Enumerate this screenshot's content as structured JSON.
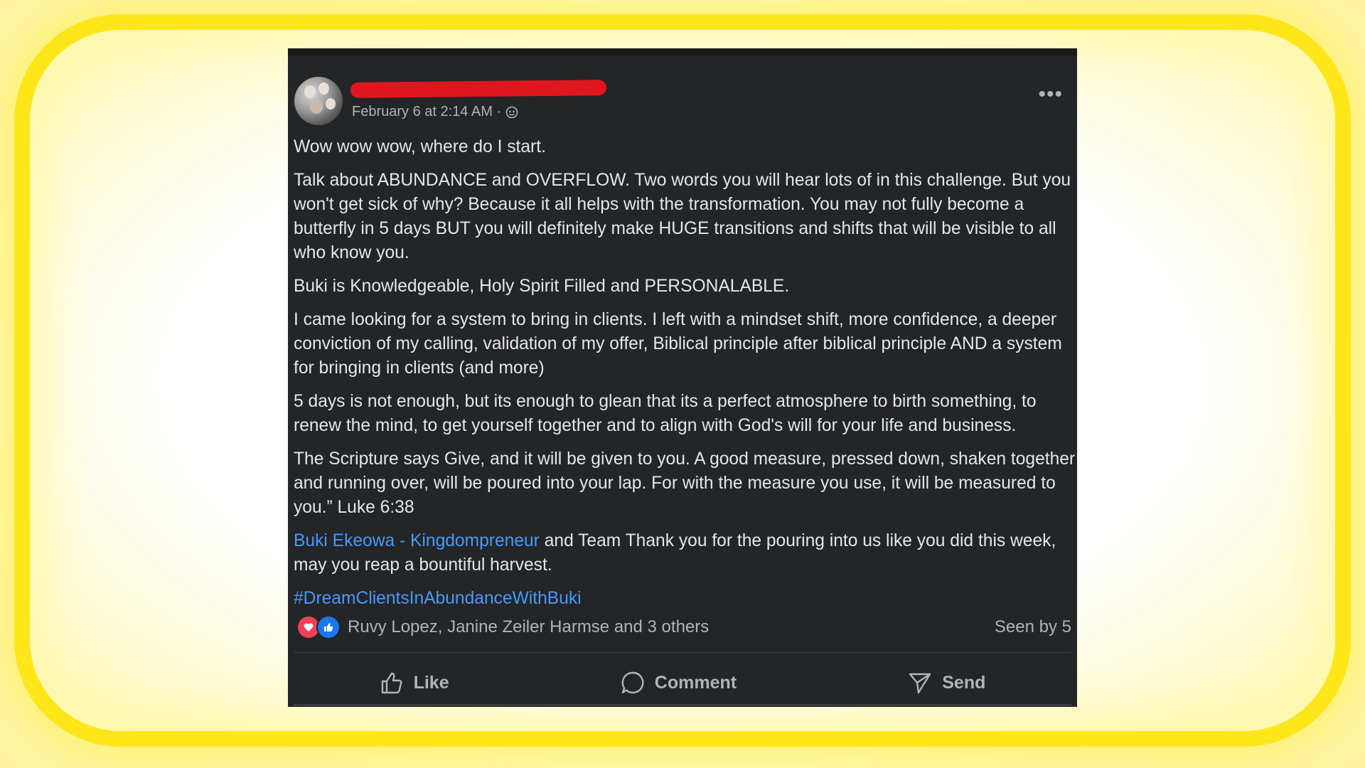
{
  "post": {
    "timestamp": "February 6 at 2:14 AM ·",
    "paragraphs": [
      "Wow wow wow, where do I start.",
      "Talk about ABUNDANCE and OVERFLOW. Two words you will hear lots of in this challenge. But you won't get sick of why? Because it all helps with the transformation. You may not fully become a butterfly in 5 days BUT you will definitely make HUGE transitions and shifts that will be visible to all who know you.",
      "Buki is Knowledgeable, Holy Spirit Filled and PERSONALABLE.",
      "I came looking for a system to bring in clients. I left with a mindset shift, more confidence, a deeper conviction of my calling, validation of my offer, Biblical principle after biblical principle AND a system for bringing in clients (and more)",
      "5 days is not enough, but its enough to glean that its a perfect atmosphere to birth something, to renew the mind, to get yourself together and to align with God's will for your life and business.",
      "The Scripture says Give, and it will be given to you. A good measure, pressed down, shaken together and running over, will be poured into your lap. For with the measure you use, it will be measured to you.” Luke 6:38"
    ],
    "mention_link": "Buki Ekeowa - Kingdompreneur",
    "mention_rest": " and Team Thank you for the pouring into us like you did this week, may you reap a bountiful harvest.",
    "hashtag": "#DreamClientsInAbundanceWithBuki"
  },
  "reactions": {
    "names": "Ruvy Lopez, Janine Zeiler Harmse and 3 others",
    "seen": "Seen by 5"
  },
  "actions": {
    "like": "Like",
    "comment": "Comment",
    "send": "Send"
  },
  "colors": {
    "card_bg": "#242526",
    "text": "#e4e6eb",
    "muted": "#b0b3b8",
    "link": "#4599ff",
    "redaction": "#e0161f",
    "frame_glow": "#ffe61a"
  }
}
